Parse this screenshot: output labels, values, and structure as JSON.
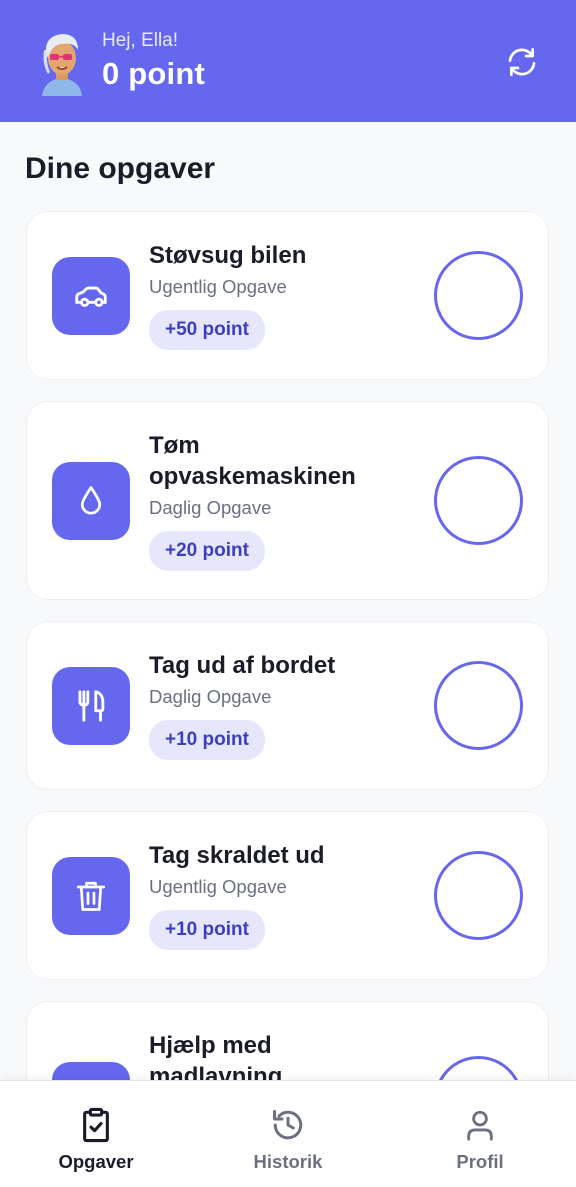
{
  "header": {
    "greeting": "Hej, Ella!",
    "points": "0 point",
    "background_color": "#6568ef",
    "refresh_icon": "refresh-icon",
    "avatar": "avatar-ella"
  },
  "main": {
    "section_title": "Dine opgaver",
    "tasks": [
      {
        "title": "Støvsug bilen",
        "subtitle": "Ugentlig Opgave",
        "badge": "+50 point",
        "icon": "car-icon",
        "completed": false
      },
      {
        "title": "Tøm opvaskemaskinen",
        "subtitle": "Daglig Opgave",
        "badge": "+20 point",
        "icon": "water-drop-icon",
        "completed": false
      },
      {
        "title": "Tag ud af bordet",
        "subtitle": "Daglig Opgave",
        "badge": "+10 point",
        "icon": "cutlery-icon",
        "completed": false
      },
      {
        "title": "Tag skraldet ud",
        "subtitle": "Ugentlig Opgave",
        "badge": "+10 point",
        "icon": "trash-icon",
        "completed": false
      },
      {
        "title": "Hjælp med madlavning",
        "subtitle": "",
        "badge": "",
        "icon": "task-icon",
        "completed": false
      }
    ]
  },
  "bottom_nav": {
    "items": [
      {
        "label": "Opgaver",
        "icon": "clipboard-check-icon",
        "active": true
      },
      {
        "label": "Historik",
        "icon": "history-icon",
        "active": false
      },
      {
        "label": "Profil",
        "icon": "user-icon",
        "active": false
      }
    ]
  },
  "colors": {
    "accent": "#6568ef",
    "badge_bg": "#e6e7fc",
    "badge_text": "#3c3fc0"
  }
}
